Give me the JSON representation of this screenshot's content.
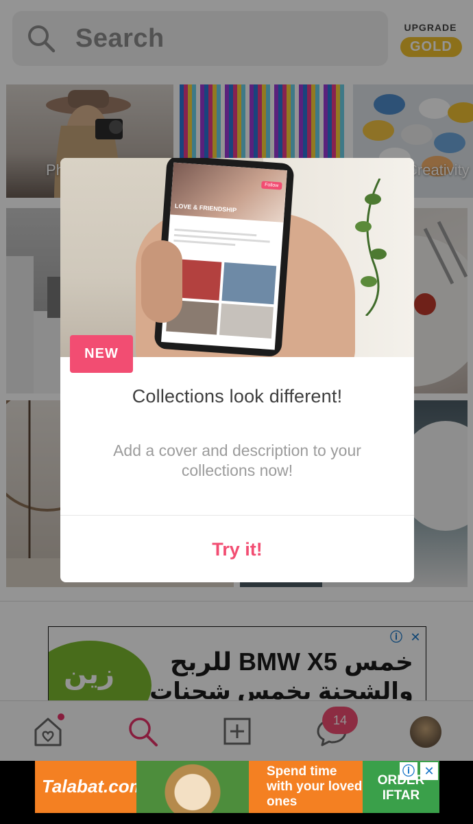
{
  "header": {
    "search_placeholder": "Search",
    "upgrade_label": "UPGRADE",
    "gold_label": "GOLD"
  },
  "grid": {
    "tile_labels": [
      "Ph",
      "Creativity"
    ]
  },
  "ad_banner": {
    "brand": "زين",
    "line1": "خمس BMW X5 للربح",
    "line2": "والشحنة بخمس شحنات",
    "info_icon": "ⓘ",
    "close_icon": "✕"
  },
  "bottom_nav": {
    "chat_badge": "14",
    "items": [
      "home-icon",
      "search-icon",
      "add-icon",
      "chat-icon",
      "profile-avatar"
    ]
  },
  "bottom_ad": {
    "brand": "Talabat.com",
    "tagline": "Spend time with your loved ones",
    "cta": "ORDER IFTAR",
    "info_icon": "ⓘ",
    "close_icon": "✕"
  },
  "modal": {
    "badge": "NEW",
    "title": "Collections look different!",
    "description": "Add a cover and description to your collections now!",
    "button": "Try it!",
    "phone_screen_title": "LOVE & FRIENDSHIP",
    "phone_screen_follow": "Follow"
  },
  "colors": {
    "accent": "#f24d72",
    "gold": "#f2c12e",
    "overlay": "rgba(0,0,0,0.42)"
  }
}
